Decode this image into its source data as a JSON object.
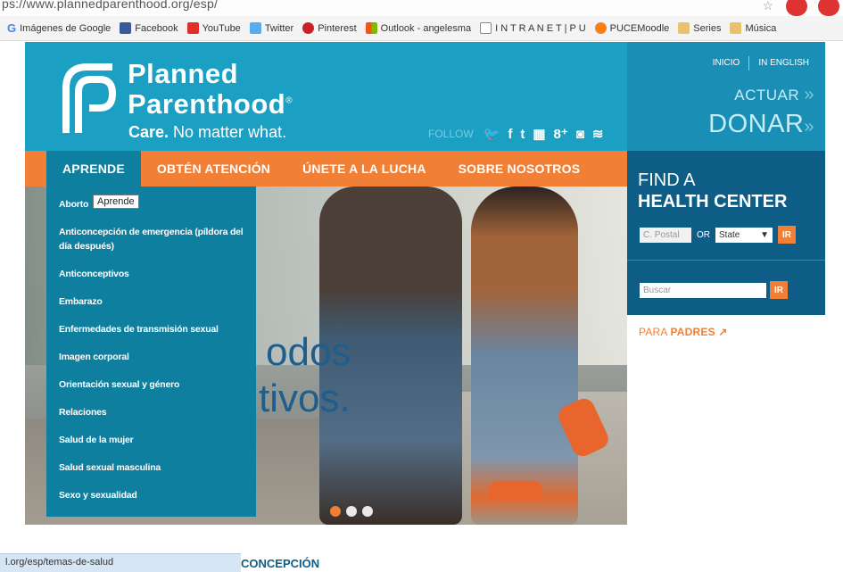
{
  "browser": {
    "url": "ps://www.plannedparenthood.org/esp/",
    "bookmarks": [
      "Imágenes de Google",
      "Facebook",
      "YouTube",
      "Twitter",
      "Pinterest",
      "Outlook - angelesma",
      "I N T R A N E T | P U",
      "PUCEMoodle",
      "Series",
      "Música"
    ],
    "colors": {
      "google": "#4285f4",
      "facebook": "#3b5998",
      "youtube": "#e52d27",
      "twitter": "#55acee",
      "pinterest": "#cb2027",
      "outlook": "#f65314",
      "moodle": "#f98012",
      "folder": "#e9c36b"
    }
  },
  "header": {
    "brand_line1": "Planned",
    "brand_line2": "Parenthood",
    "reg_mark": "®",
    "tagline_bold": "Care.",
    "tagline_rest": " No matter what.",
    "follow_label": "FOLLOW",
    "social": [
      "twitter-icon",
      "facebook-icon",
      "tumblr-icon",
      "youtube-icon",
      "googleplus-icon",
      "instagram-icon",
      "rss-icon"
    ],
    "social_glyphs": [
      "🐦",
      "f",
      "t",
      "▦",
      "8⁺",
      "◙",
      "≋"
    ]
  },
  "topnav": {
    "inicio": "INICIO",
    "english": "IN ENGLISH",
    "actuar": "ACTUAR",
    "donar": "DONAR",
    "chevron": "»"
  },
  "nav": {
    "items": [
      "APRENDE",
      "OBTÉN ATENCIÓN",
      "ÚNETE A LA LUCHA",
      "SOBRE NOSOTROS"
    ]
  },
  "dropdown": {
    "items": [
      "Aborto",
      "Anticoncepción de emergencia (píldora del día después)",
      "Anticonceptivos",
      "Embarazo",
      "Enfermedades de transmisión sexual",
      "Imagen corporal",
      "Orientación sexual y género",
      "Relaciones",
      "Salud de la mujer",
      "Salud sexual masculina",
      "Sexo y sexualidad"
    ],
    "tooltip": "Aprende"
  },
  "hero": {
    "line1": "odos",
    "line2": "tivos.",
    "slides": 3,
    "active_slide": 1
  },
  "find": {
    "title1": "FIND A",
    "title2": "HEALTH CENTER",
    "postal_placeholder": "C. Postal",
    "or_label": "OR",
    "state_value": "State",
    "go_label": "IR",
    "search_placeholder": "Buscar",
    "search_go": "IR"
  },
  "parents": {
    "prefix": "PARA ",
    "bold": "PADRES",
    "arrow": "↗"
  },
  "statusbar": {
    "url": "l.org/esp/temas-de-salud"
  },
  "bottom": {
    "heading": "CONCEPCIÓN"
  },
  "accent": "#f27f36",
  "brand_blue": "#1ba0c4"
}
